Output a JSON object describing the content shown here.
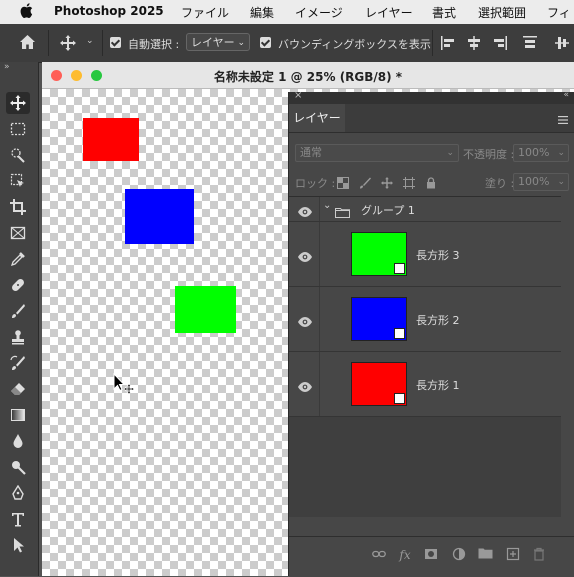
{
  "menubar": {
    "app_name": "Photoshop 2025",
    "items": [
      "ファイル",
      "編集",
      "イメージ",
      "レイヤー",
      "書式",
      "選択範囲",
      "フィ"
    ]
  },
  "options_bar": {
    "auto_select_label": "自動選択 :",
    "auto_select_value": "レイヤー",
    "bounding_box_label": "バウンディングボックスを表示"
  },
  "document": {
    "title": "名称未設定 1 @ 25% (RGB/8) *"
  },
  "canvas_shapes": [
    {
      "name": "red-rectangle",
      "color": "#ff0000"
    },
    {
      "name": "blue-rectangle",
      "color": "#0000ff"
    },
    {
      "name": "green-rectangle",
      "color": "#00ff00"
    }
  ],
  "layers_panel": {
    "tab_label": "レイヤー",
    "blend_mode": "通常",
    "opacity_label": "不透明度 :",
    "opacity_value": "100%",
    "lock_label": "ロック :",
    "fill_label": "塗り :",
    "fill_value": "100%",
    "group_name": "グループ 1",
    "layers": [
      {
        "name": "長方形 3",
        "color": "#00ff00"
      },
      {
        "name": "長方形 2",
        "color": "#0000ff"
      },
      {
        "name": "長方形 1",
        "color": "#ff0000"
      }
    ]
  },
  "colors": {
    "menubar_bg": "#ececec",
    "ui_dark": "#3d3d3d",
    "panel_bg": "#474747"
  }
}
